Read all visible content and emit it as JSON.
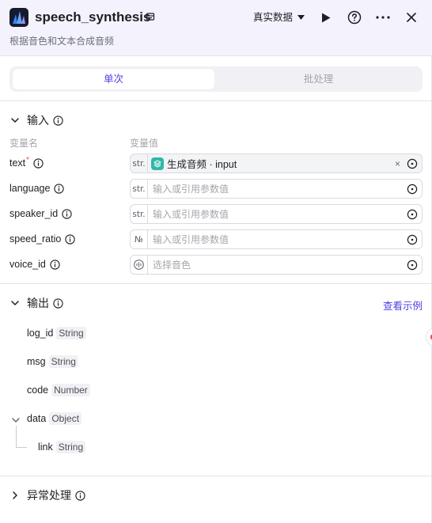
{
  "header": {
    "title": "speech_synthesis",
    "subtitle": "根据音色和文本合成音频",
    "data_mode": "真实数据"
  },
  "tabs": [
    {
      "label": "单次",
      "active": true
    },
    {
      "label": "批处理",
      "active": false
    }
  ],
  "input_section": {
    "title": "输入",
    "col_name": "变量名",
    "col_value": "变量值",
    "params": [
      {
        "name": "text",
        "required": true,
        "type": "str.",
        "value_ref": "生成音频 · input",
        "placeholder": ""
      },
      {
        "name": "language",
        "required": false,
        "type": "str.",
        "placeholder": "输入或引用参数值"
      },
      {
        "name": "speaker_id",
        "required": false,
        "type": "str.",
        "placeholder": "输入或引用参数值"
      },
      {
        "name": "speed_ratio",
        "required": false,
        "type": "№",
        "placeholder": "输入或引用参数值"
      },
      {
        "name": "voice_id",
        "required": false,
        "type": "voice-icon",
        "placeholder": "选择音色"
      }
    ]
  },
  "output_section": {
    "title": "输出",
    "example_link": "查看示例",
    "fields": [
      {
        "name": "log_id",
        "type": "String"
      },
      {
        "name": "msg",
        "type": "String"
      },
      {
        "name": "code",
        "type": "Number"
      },
      {
        "name": "data",
        "type": "Object"
      },
      {
        "name": "link",
        "type": "String"
      }
    ]
  },
  "error_section": {
    "title": "异常处理"
  },
  "colors": {
    "accent": "#4e40e5",
    "header_bg": "#f4f3fd",
    "ref_icon": "#2fb7a8"
  }
}
